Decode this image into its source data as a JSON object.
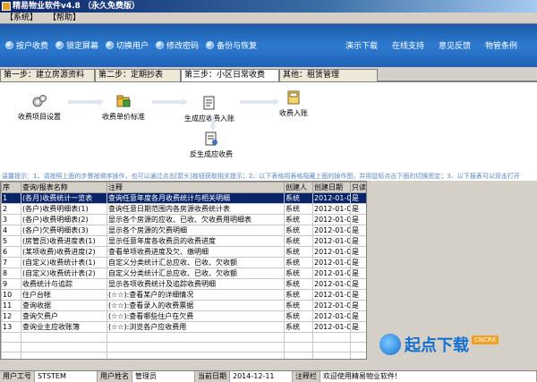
{
  "window": {
    "title": "精易物业软件v4.8 （永久免费版）"
  },
  "menu": {
    "items": [
      "【系统】",
      "【帮助】"
    ]
  },
  "toolbar": {
    "left": [
      "按户收费",
      "锁定屏幕",
      "切换用户",
      "修改密码",
      "备份与恢复"
    ],
    "right": [
      "演示下载",
      "在线支持",
      "意见反馈",
      "物管条例"
    ]
  },
  "steps": [
    "第一步：建立房源资料",
    "第二步：定期抄表",
    "第三步：小区日常收费",
    "其他：租赁管理"
  ],
  "flow": {
    "nodes": [
      "收费项目设置",
      "收费单价标准",
      "生成应收费入账",
      "收费入账",
      "反生成应收费"
    ]
  },
  "hint": "温馨提示：1、请按照上面的步骤按顺序操作，也可以通过点击[箭头]按钮获取相关提示；2、以下表格用表格隐藏上面的操作图，并用鼠标点击下面的切换而定；3、以下报表可以双击打开",
  "table": {
    "columns": [
      "序",
      "查询/报表名称",
      "注释",
      "创建人",
      "创建日期",
      "只读"
    ],
    "rows": [
      [
        "1",
        "(各月)收费统计一览表",
        "查询任意年度各月收费统计与相关明细",
        "系统",
        "2012-01-01",
        "是"
      ],
      [
        "2",
        "(各户)收费明细表(1)",
        "查询任意日期范围内各房源收费统计表",
        "系统",
        "2012-01-01",
        "是"
      ],
      [
        "3",
        "(各户)收费明细表(2)",
        "显示各个房源的应收、已收、欠收费用明细表",
        "系统",
        "2012-01-01",
        "是"
      ],
      [
        "4",
        "(各户)欠费明细表(3)",
        "显示各个房源的欠费明细",
        "系统",
        "2012-01-01",
        "是"
      ],
      [
        "5",
        "(房管员)收费进度表(1)",
        "显示任意年度各收费员的收费进度",
        "系统",
        "2012-01-01",
        "是"
      ],
      [
        "6",
        "(某项收费)收费进度(2)",
        "查看单项收费进度及欠、缴明细",
        "系统",
        "2012-01-01",
        "是"
      ],
      [
        "7",
        "(自定义)收费统计表(1)",
        "自定义分类统计汇总应收、已收、欠收额",
        "系统",
        "2012-01-01",
        "是"
      ],
      [
        "8",
        "(自定义)收费统计表(2)",
        "自定义分类统计汇总应收、已收、欠收额",
        "系统",
        "2012-01-01",
        "是"
      ],
      [
        "9",
        "收费统计与追踪",
        "显示各项收费统计及追踪收费明细",
        "系统",
        "2012-01-01",
        "是"
      ],
      [
        "10",
        "住户台帐",
        "(☆☆):查看某户的详细情况",
        "系统",
        "2012-01-01",
        "是"
      ],
      [
        "11",
        "查询收据",
        "(☆☆):查看录入的收费票据",
        "系统",
        "2012-01-01",
        "是"
      ],
      [
        "12",
        "查询欠费户",
        "(☆☆):查看哪些住户在欠费",
        "系统",
        "2012-01-01",
        "是"
      ],
      [
        "13",
        "查询业主应收账簿",
        "(☆☆):浏览各户应收费用",
        "系统",
        "2012-01-01",
        "是"
      ]
    ]
  },
  "status": {
    "user_code_label": "用户工号",
    "user_code": "STSTEM",
    "user_name_label": "用户姓名",
    "user_name": "管理员",
    "date_label": "当前日期",
    "date": "2014-12-11",
    "note_label": "注释栏",
    "note": "欢迎使用精易物业软件!"
  },
  "watermark": {
    "text": "起点下载",
    "badge": "CNCRK"
  },
  "colors": {
    "toolbar": "#2e7bd0",
    "selection": "#0a246a",
    "hint": "#5a86c8"
  }
}
